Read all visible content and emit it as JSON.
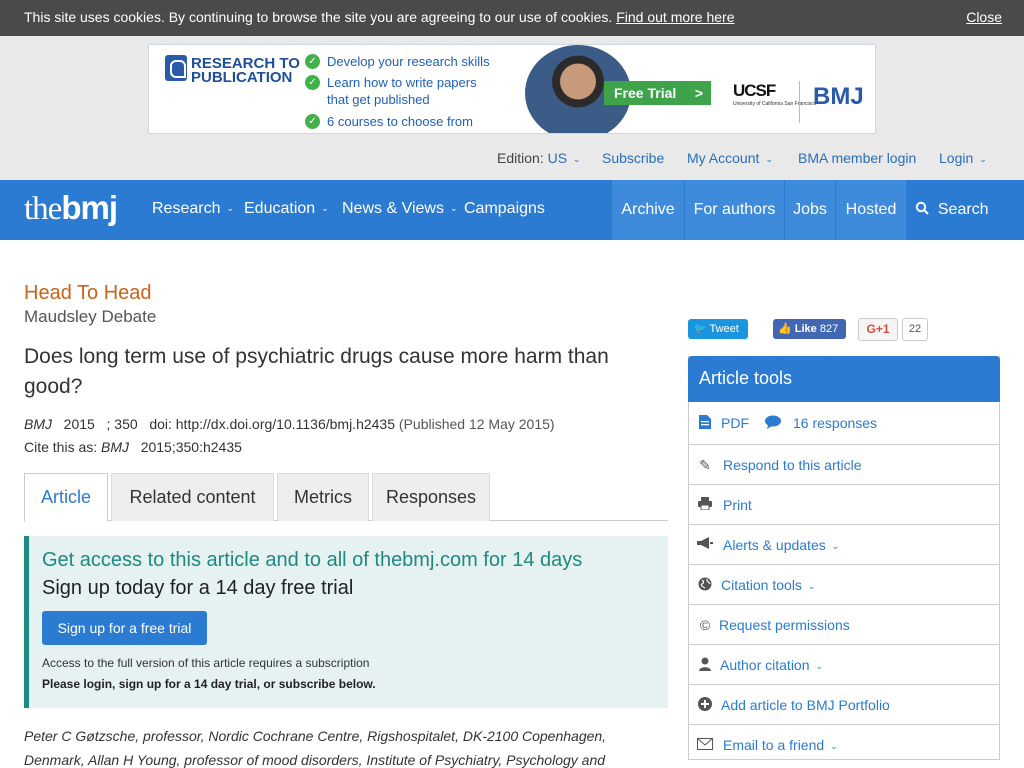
{
  "cookie": {
    "message": "This site uses cookies. By continuing to browse the site you are agreeing to our use of cookies.",
    "link": "Find out more here",
    "close": "Close"
  },
  "ad": {
    "brand_line1": "RESEARCH TO",
    "brand_line2": "PUBLICATION",
    "bullets": [
      "Develop your research skills",
      "Learn how to write papers",
      "that get published",
      "6 courses to choose from"
    ],
    "cta": "Free Trial",
    "partner": "UCSF",
    "partner_sub": "University of California San Francisco",
    "logo": "BMJ"
  },
  "topnav": {
    "edition_label": "Edition:",
    "edition_value": "US",
    "subscribe": "Subscribe",
    "my_account": "My Account",
    "bma_login": "BMA member login",
    "login": "Login"
  },
  "mainnav": {
    "brand_the": "the",
    "brand_bmj": "bmj",
    "research": "Research",
    "education": "Education",
    "news": "News & Views",
    "campaigns": "Campaigns",
    "archive": "Archive",
    "for_authors": "For authors",
    "jobs": "Jobs",
    "hosted": "Hosted",
    "search": "Search"
  },
  "article": {
    "section": "Head To Head",
    "subsection": "Maudsley Debate",
    "title": "Does long term use of psychiatric drugs cause more harm than good?",
    "journal": "BMJ",
    "year": "2015",
    "volume": "; 350",
    "doi": "doi: http://dx.doi.org/10.1136/bmj.h2435",
    "published": "(Published 12 May 2015)",
    "cite_label": "Cite this as:",
    "cite_journal": "BMJ",
    "cite_ref": "2015;350:h2435",
    "authors": "Peter C Gøtzsche, professor, Nordic Cochrane Centre, Rigshospitalet, DK-2100 Copenhagen, Denmark, Allan H Young, professor of mood disorders, Institute of Psychiatry, Psychology and"
  },
  "tabs": [
    "Article",
    "Related content",
    "Metrics",
    "Responses"
  ],
  "access": {
    "heading": "Get access to this article and to all of thebmj.com for 14 days",
    "subheading": "Sign up today for a 14 day free trial",
    "button": "Sign up for a free trial",
    "note": "Access to the full version of this article requires a subscription",
    "note_bold": "Please login, sign up for a 14 day trial, or subscribe below."
  },
  "social": {
    "tweet": "Tweet",
    "like": "Like",
    "like_count": "827",
    "gplus": "G+1",
    "gplus_count": "22"
  },
  "tools": {
    "header": "Article tools",
    "pdf": "PDF",
    "responses": "16 responses",
    "respond": "Respond to this article",
    "print": "Print",
    "alerts": "Alerts & updates",
    "citation_tools": "Citation tools",
    "permissions": "Request permissions",
    "author_citation": "Author citation",
    "portfolio": "Add article to BMJ Portfolio",
    "email": "Email to a friend"
  },
  "colors": {
    "brand_blue": "#2a7bd1",
    "section_orange": "#c8621c",
    "access_teal": "#1c8a7e"
  }
}
